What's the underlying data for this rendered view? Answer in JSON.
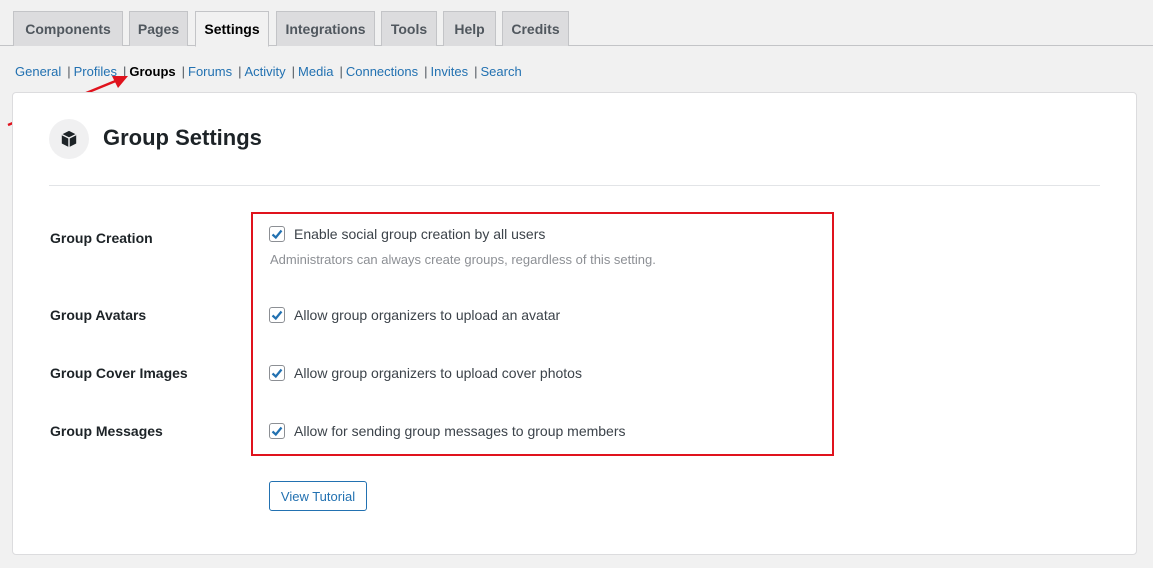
{
  "tabs": [
    {
      "label": "Components",
      "active": false
    },
    {
      "label": "Pages",
      "active": false
    },
    {
      "label": "Settings",
      "active": true
    },
    {
      "label": "Integrations",
      "active": false
    },
    {
      "label": "Tools",
      "active": false
    },
    {
      "label": "Help",
      "active": false
    },
    {
      "label": "Credits",
      "active": false
    }
  ],
  "subnav": [
    {
      "label": "General",
      "current": false
    },
    {
      "label": "Profiles",
      "current": false
    },
    {
      "label": "Groups",
      "current": true
    },
    {
      "label": "Forums",
      "current": false
    },
    {
      "label": "Activity",
      "current": false
    },
    {
      "label": "Media",
      "current": false
    },
    {
      "label": "Connections",
      "current": false
    },
    {
      "label": "Invites",
      "current": false
    },
    {
      "label": "Search",
      "current": false
    }
  ],
  "subnav_separator": "|",
  "panel": {
    "icon": "box-icon",
    "title": "Group Settings",
    "rows": [
      {
        "label": "Group Creation",
        "option": "Enable social group creation by all users",
        "checked": true
      },
      {
        "label": "Group Avatars",
        "option": "Allow group organizers to upload an avatar",
        "checked": true
      },
      {
        "label": "Group Cover Images",
        "option": "Allow group organizers to upload cover photos",
        "checked": true
      },
      {
        "label": "Group Messages",
        "option": "Allow for sending group messages to group members",
        "checked": true
      }
    ],
    "creation_description": "Administrators can always create groups, regardless of this setting.",
    "tutorial_button": "View Tutorial"
  },
  "colors": {
    "accent": "#2271b1",
    "annotation": "#e0131d"
  }
}
